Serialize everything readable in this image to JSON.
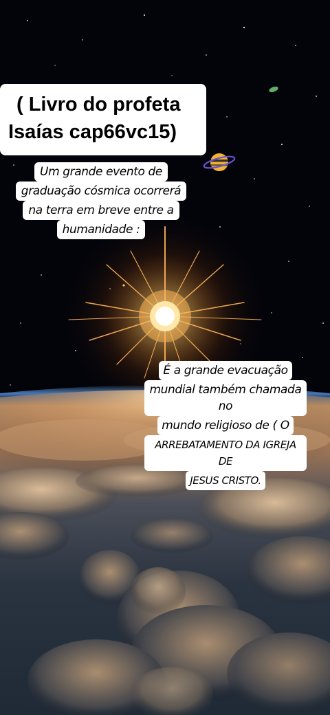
{
  "captions": {
    "title": {
      "line1": "( Livro do profeta",
      "line2": "Isaías  cap66vc15)"
    },
    "intro": [
      "Um grande evento  de",
      "graduação cósmica ocorrerá",
      "na terra em breve entre a",
      "humanidade :"
    ],
    "explanation": [
      "É a grande evacuação",
      "mundial também chamada no",
      "mundo religioso de ( O",
      "ARREBATAMENTO DA IGREJA DE",
      "JESUS CRISTO."
    ]
  },
  "scene": {
    "icons": [
      "ringed-planet-icon",
      "sun-star-icon",
      "earth-horizon"
    ],
    "colors": {
      "space": "#03040a",
      "sun_core": "#fff4d0",
      "sun_glow": "#ff9a2e",
      "atmosphere": "#3d6fae",
      "clouds_light": "#d9a878",
      "clouds_shadow": "#2d3440"
    }
  }
}
